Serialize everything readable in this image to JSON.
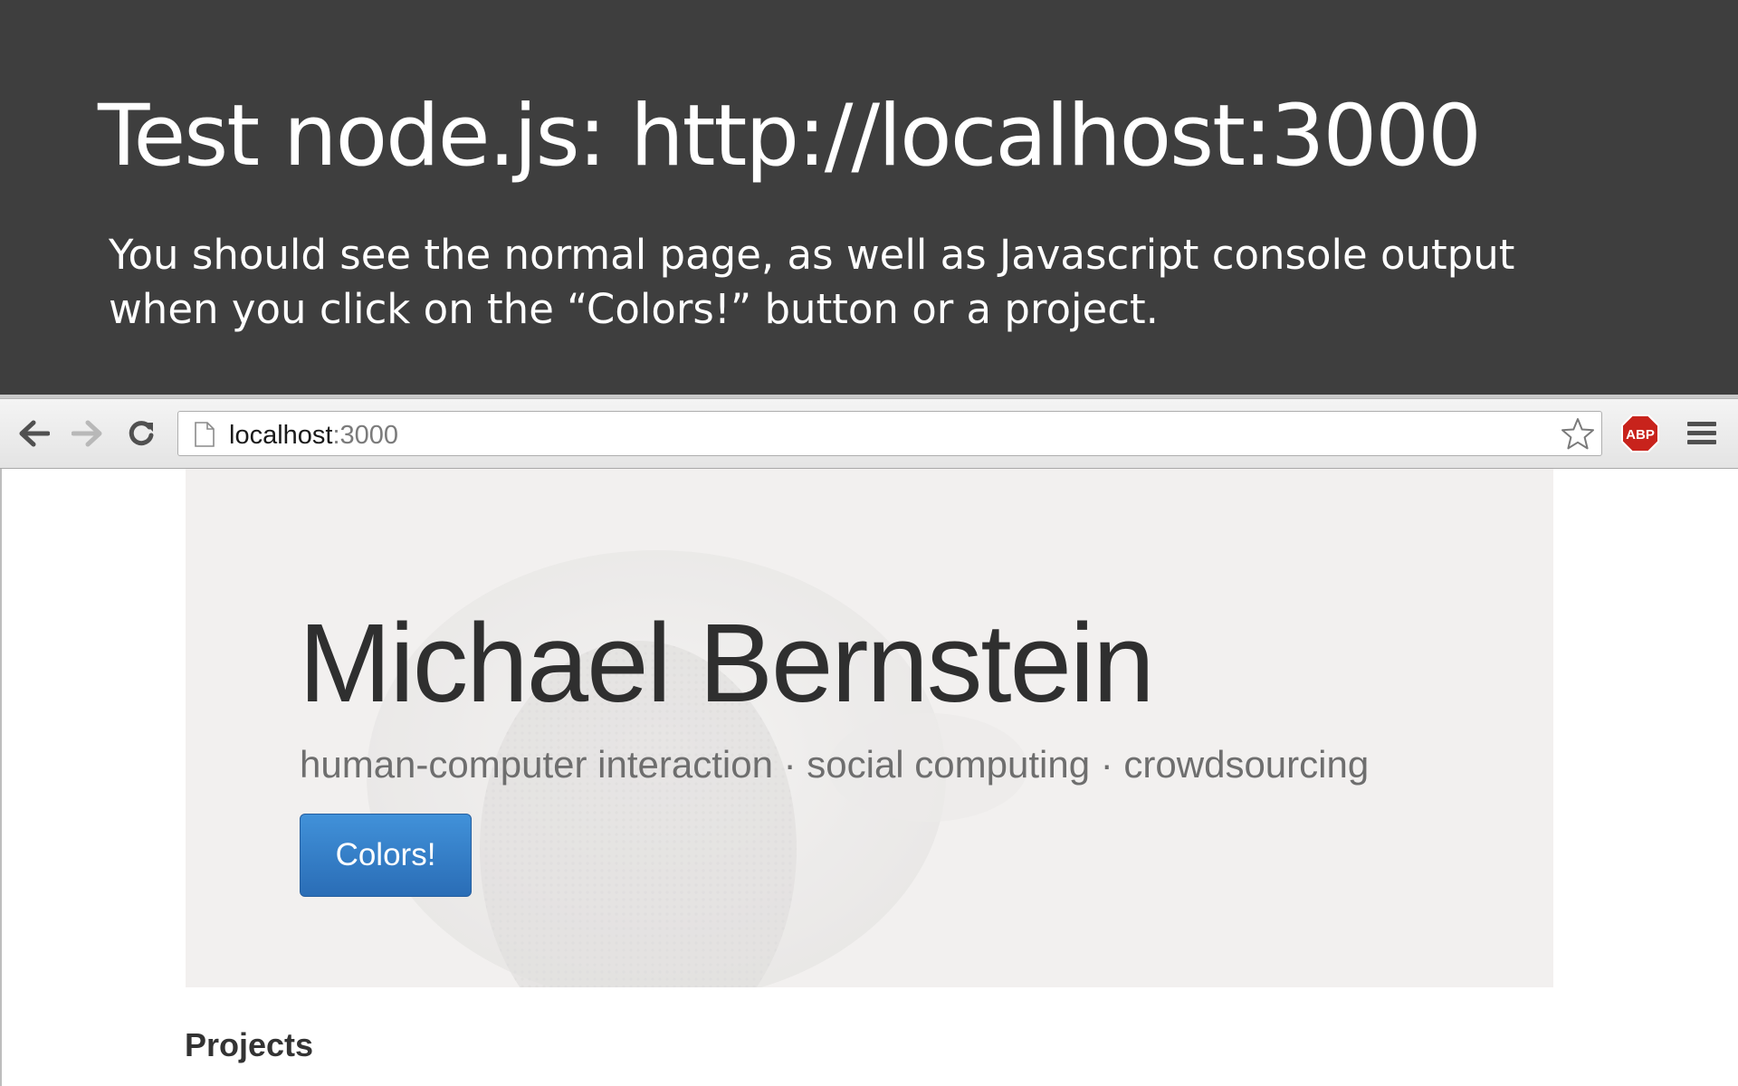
{
  "slide": {
    "title": "Test node.js: http://localhost:3000",
    "subtitle": "You should see the normal page, as well as Javascript console output when you click on the “Colors!” button or a project."
  },
  "browser": {
    "address_host": "localhost",
    "address_port": ":3000",
    "icons": {
      "back": "arrow-left",
      "forward": "arrow-right",
      "reload": "refresh",
      "page": "document",
      "bookmark": "star",
      "adblock": "ABP",
      "menu": "hamburger"
    }
  },
  "page": {
    "name": "Michael Bernstein",
    "tagline": "human-computer interaction · social computing · crowdsourcing",
    "colors_button_label": "Colors!",
    "projects_heading": "Projects"
  },
  "colors": {
    "slide_background": "#3e3e3e",
    "button_blue": "#2a6db6",
    "adblock_red": "#c8231c"
  }
}
